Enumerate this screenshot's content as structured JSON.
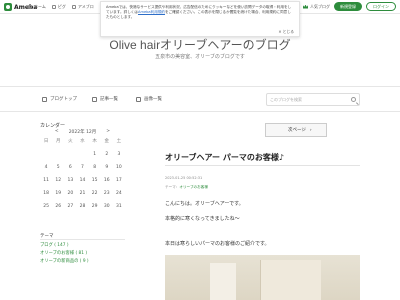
{
  "topbar": {
    "logo_text": "Ameba",
    "nav": [
      {
        "label": "ホーム",
        "icon": "home-icon"
      },
      {
        "label": "ピグ",
        "icon": "pigg-icon"
      },
      {
        "label": "アメブロ",
        "icon": "blog-icon"
      }
    ],
    "popular_label": "人気ブログ",
    "register_label": "新規登録",
    "login_label": "ログイン"
  },
  "cookie": {
    "text_before": "Amebaでは、快適なサービス提供や利用状況、広告配信のためにクッキーなどを使い訪問データの取得・利用をしています。詳しくは",
    "link_text": "Ameba利用規約",
    "text_after": "をご確認ください。この表示を閉じるか閲覧を続けた場合、利用規約に同意したものとします。",
    "close_label": "とじる"
  },
  "header": {
    "title": "Olive hairオリーブヘアーのブログ",
    "description": "五泉市の美容室、オリーブのブログです"
  },
  "nav": {
    "items": [
      {
        "label": "ブログトップ",
        "icon": "blog-top-icon"
      },
      {
        "label": "記事一覧",
        "icon": "article-list-icon"
      },
      {
        "label": "画像一覧",
        "icon": "image-list-icon"
      }
    ],
    "search_placeholder": "このブログを検索"
  },
  "calendar": {
    "title": "カレンダー",
    "prev": "<",
    "month": "2022年 12月",
    "next": ">",
    "weekdays": [
      "日",
      "月",
      "火",
      "水",
      "木",
      "金",
      "土"
    ],
    "weeks": [
      [
        "",
        "",
        "",
        "",
        "1",
        "2",
        "3"
      ],
      [
        "4",
        "5",
        "6",
        "7",
        "8",
        "9",
        "10"
      ],
      [
        "11",
        "12",
        "13",
        "14",
        "15",
        "16",
        "17"
      ],
      [
        "18",
        "19",
        "20",
        "21",
        "22",
        "23",
        "24"
      ],
      [
        "25",
        "26",
        "27",
        "28",
        "29",
        "30",
        "31"
      ]
    ]
  },
  "themes": {
    "title": "テーマ",
    "items": [
      "ブログ ( 147 )",
      "オリーブのお客様 ( 81 )",
      "オリーブの新商品の ( 9 )"
    ]
  },
  "post": {
    "next_label": "次ページ",
    "title": "オリーブヘアー パーマのお客様♪",
    "date": "2023-01-25 00:52:31",
    "theme_prefix": "テーマ：",
    "theme_name": "オリーブのお客様",
    "theme_suffix": "",
    "paragraphs": [
      "こんにちは。オリーブヘアーです。",
      "本格的に寒くなってきましたね〜",
      "本日は寒らしいパーマのお客様のご紹介です。"
    ]
  }
}
